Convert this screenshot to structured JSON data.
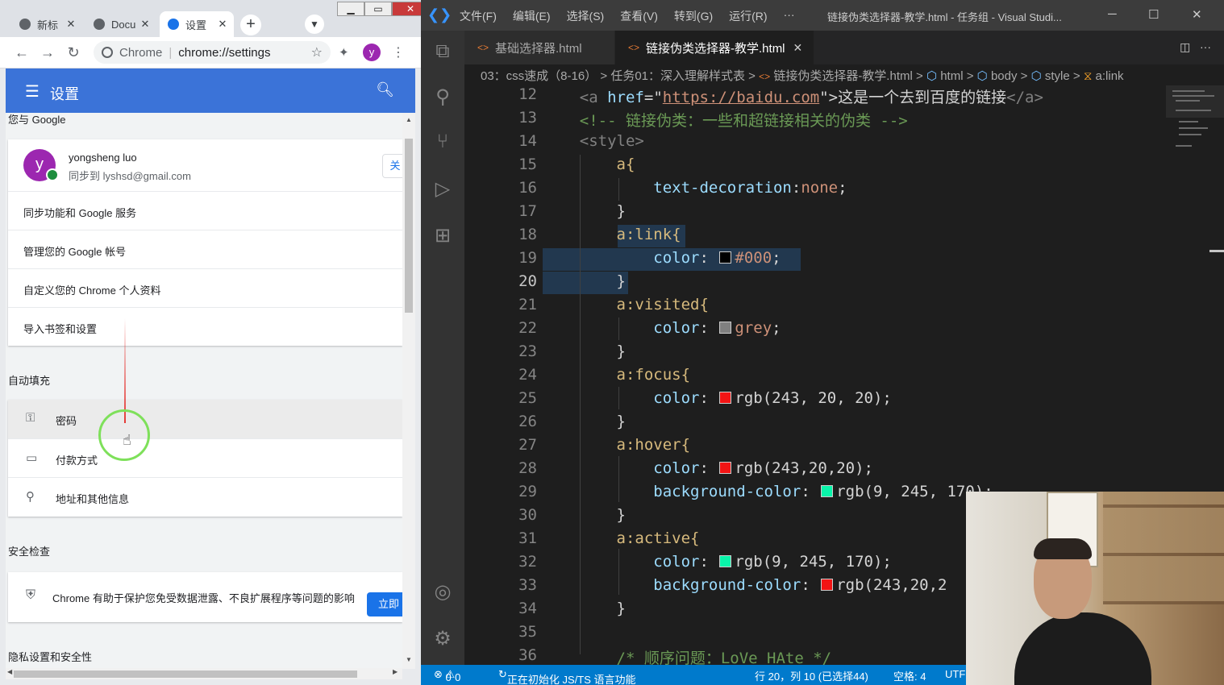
{
  "chrome": {
    "tabs": [
      {
        "title": "新标"
      },
      {
        "title": "Docu"
      },
      {
        "title": "设置"
      }
    ],
    "new_tab": "+",
    "url_site": "Chrome",
    "url_path": "chrome://settings",
    "profile_initial": "y",
    "settings_title": "设置",
    "section_you_google": "您与 Google",
    "account_initial": "y",
    "account_name": "yongsheng luo",
    "account_sync": "同步到 lyshsd@gmail.com",
    "account_button": "关",
    "you_google_items": [
      "同步功能和 Google 服务",
      "管理您的 Google 帐号",
      "自定义您的 Chrome 个人资料",
      "导入书签和设置"
    ],
    "section_autofill": "自动填充",
    "autofill_items": [
      {
        "label": "密码",
        "icon": "key-icon"
      },
      {
        "label": "付款方式",
        "icon": "credit-card-icon"
      },
      {
        "label": "地址和其他信息",
        "icon": "location-pin-icon"
      }
    ],
    "section_safety": "安全检查",
    "safety_text": "Chrome 有助于保护您免受数据泄露、不良扩展程序等问题的影响",
    "safety_button": "立即",
    "section_privacy": "隐私设置和安全性"
  },
  "vscode": {
    "menu": [
      "文件(F)",
      "编辑(E)",
      "选择(S)",
      "查看(V)",
      "转到(G)",
      "运行(R)",
      "···"
    ],
    "window_title": "链接伪类选择器-教学.html - 任务组 - Visual Studi...",
    "tabs": [
      {
        "label": "基础选择器.html",
        "active": false
      },
      {
        "label": "链接伪类选择器-教学.html",
        "active": true
      }
    ],
    "breadcrumb": [
      "03：css速成（8-16）",
      "任务01：深入理解样式表",
      "链接伪类选择器-教学.html",
      "html",
      "body",
      "style",
      "a:link"
    ],
    "line_numbers": [
      "12",
      "13",
      "14",
      "15",
      "16",
      "17",
      "18",
      "19",
      "20",
      "21",
      "22",
      "23",
      "24",
      "25",
      "26",
      "27",
      "28",
      "29",
      "30",
      "31",
      "32",
      "33",
      "34",
      "35",
      "36"
    ],
    "current_line": "20",
    "code": {
      "l12_open": "<a",
      "l12_attr": "href",
      "l12_eq": "=\"",
      "l12_url": "https://baidu.com",
      "l12_close": "\">",
      "l12_text": "这是一个去到百度的链接",
      "l12_end": "</a>",
      "l13": "<!-- 链接伪类：一些和超链接相关的伪类 -->",
      "l14": "<style>",
      "l15": "a{",
      "l16_prop": "text-decoration",
      "l16_val": "none",
      "close_brace": "}",
      "l18": "a:link{",
      "prop_color": "color",
      "val_000": "#000",
      "l21": "a:visited{",
      "val_grey": "grey",
      "l24": "a:focus{",
      "val_rgb1": "rgb(243, 20, 20)",
      "l27": "a:hover{",
      "val_rgb2": "rgb(243,20,20)",
      "prop_bg": "background-color",
      "val_rgb3": "rgb(9, 245, 170)",
      "l31": "a:active{",
      "val_rgb4": "rgb(9, 245, 170)",
      "val_rgb5": "rgb(243,20,2",
      "l36": "/* 顺序问题：LoVe HAte */"
    },
    "swatch_colors": {
      "black": "#000000",
      "grey": "#808080",
      "red": "#f31414",
      "green": "#09f5aa"
    },
    "status": {
      "errors": "0",
      "warnings": "0",
      "initializing": "正在初始化 JS/TS 语言功能",
      "position": "行 20，列 10 (已选择44)",
      "spaces": "空格: 4",
      "encoding": "UTF"
    }
  }
}
